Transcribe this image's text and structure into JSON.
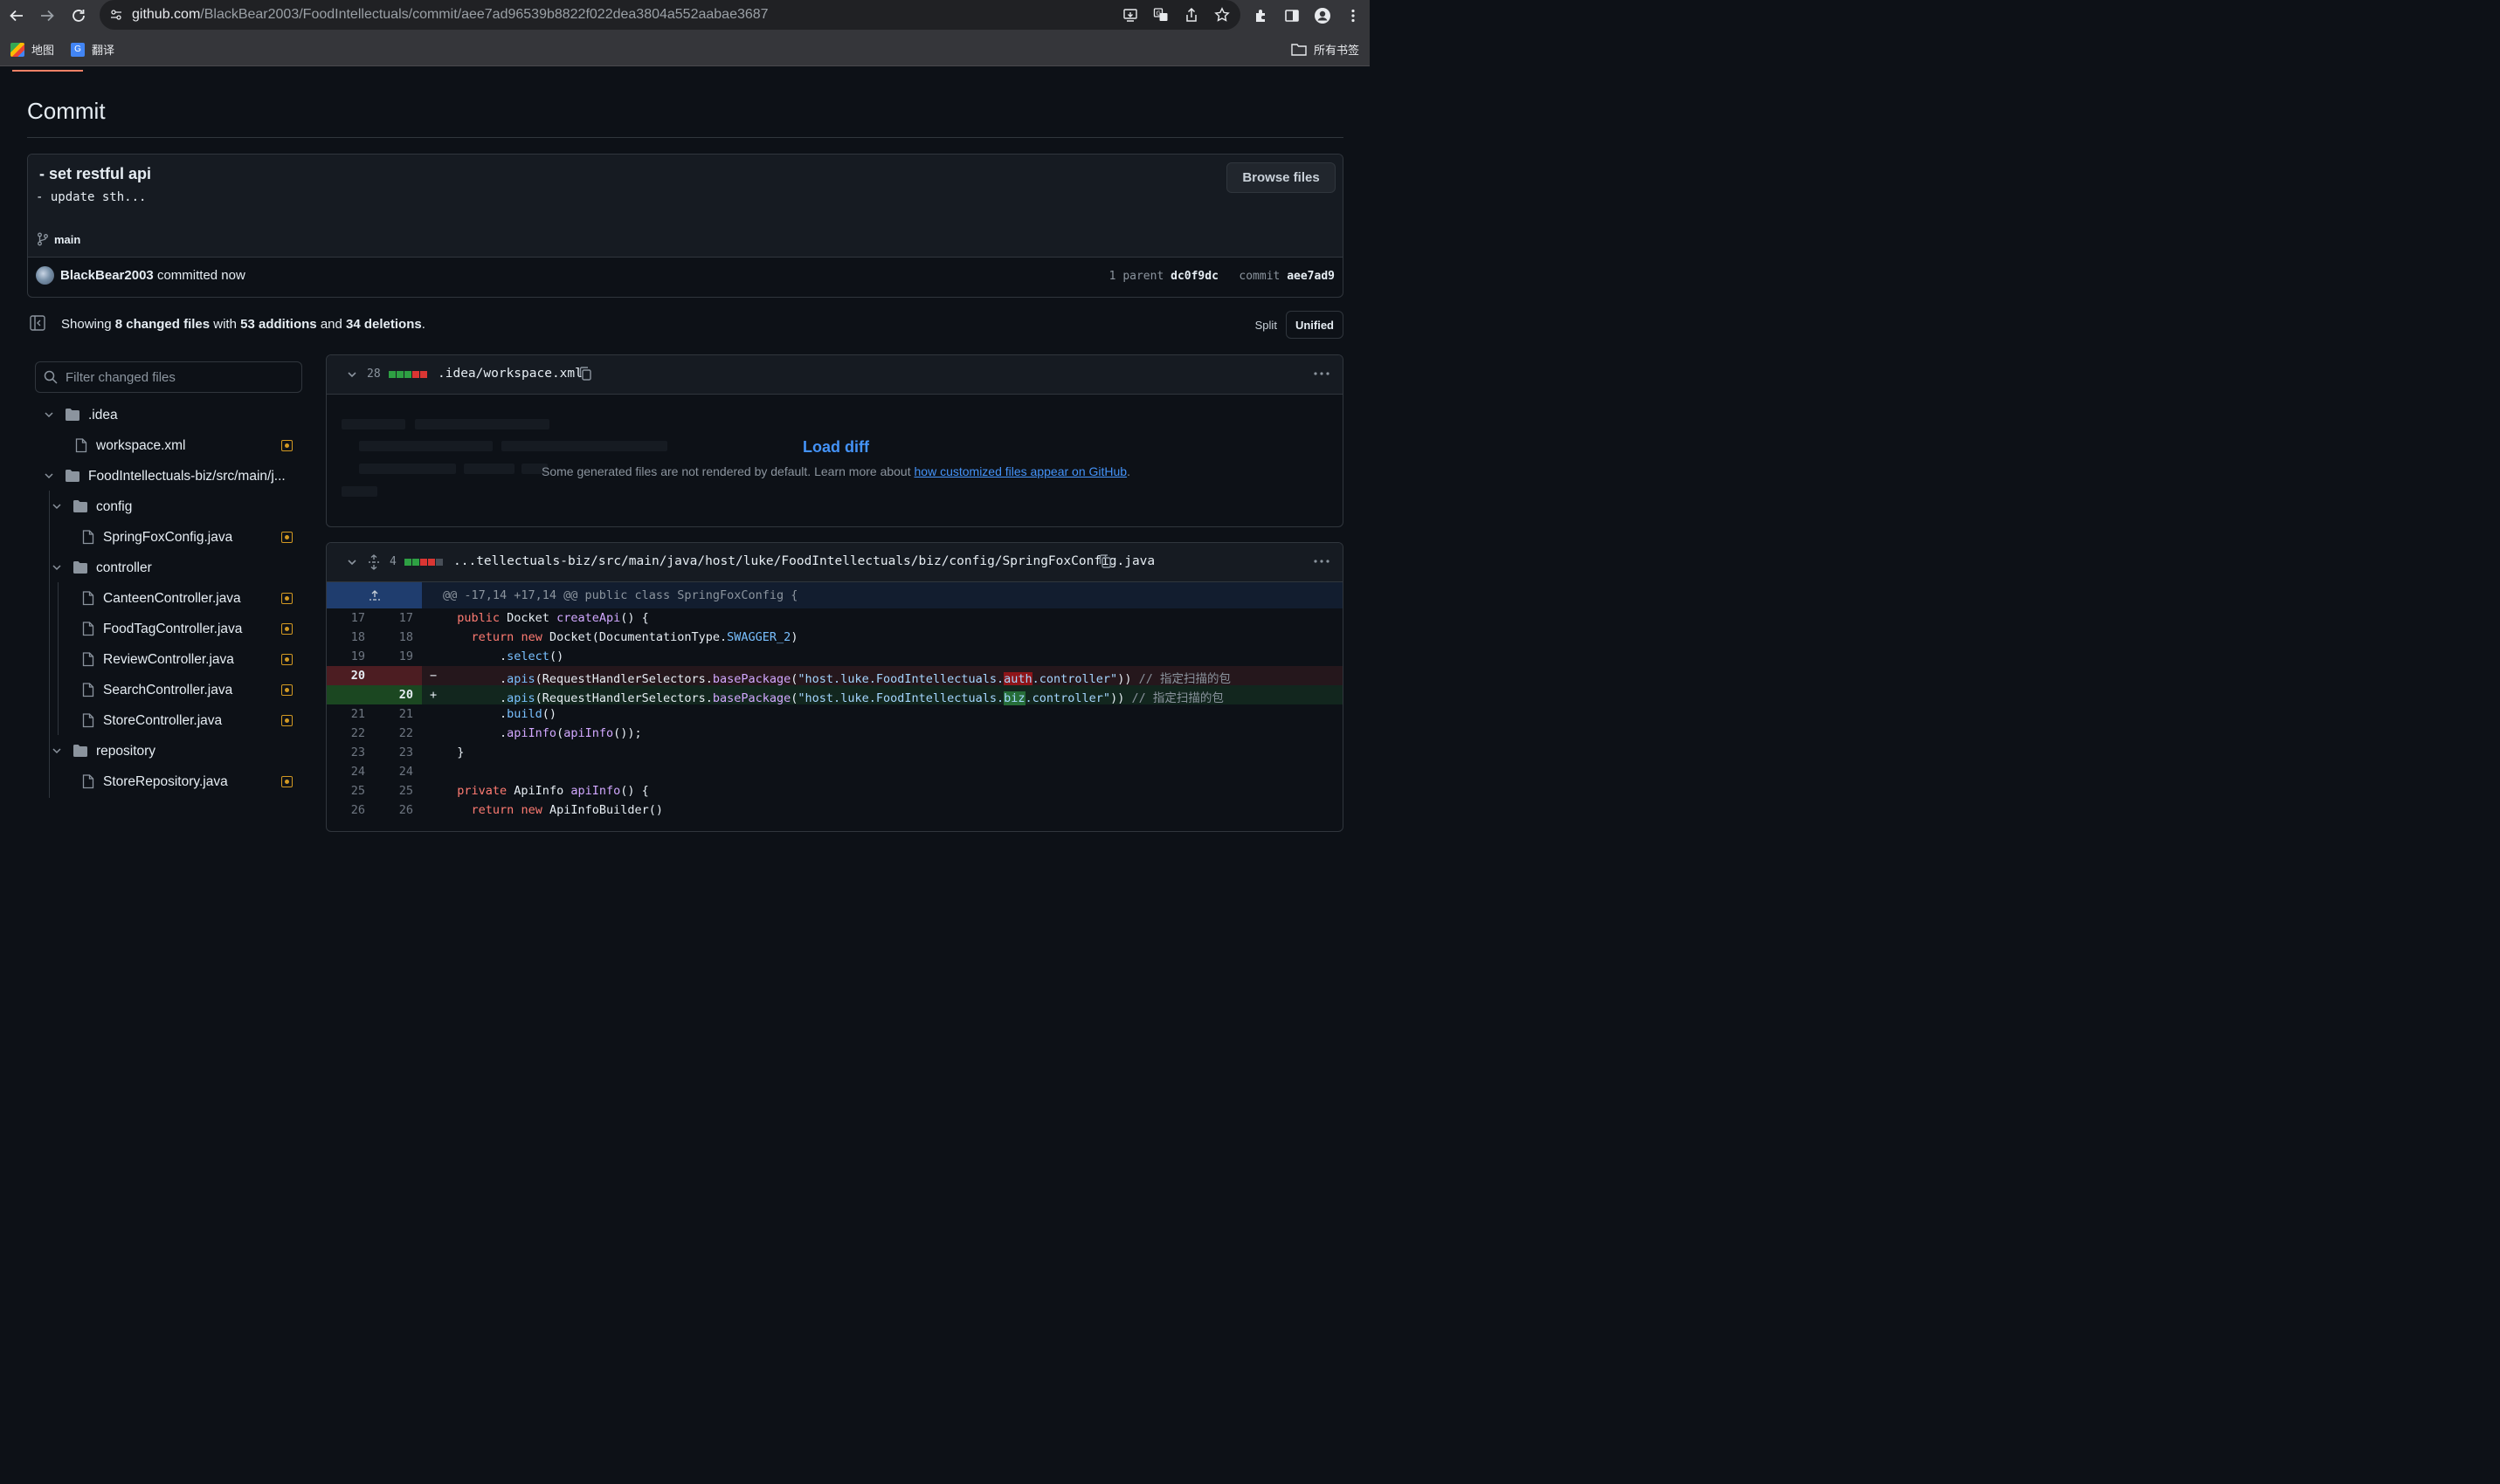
{
  "browser": {
    "url_host": "github.com",
    "url_path": "/BlackBear2003/FoodIntellectuals/commit/aee7ad96539b8822f022dea3804a552aabae3687",
    "bookmarks": [
      {
        "label": "地图",
        "icon": "maps-icon"
      },
      {
        "label": "翻译",
        "icon": "translate-icon"
      }
    ],
    "all_bookmarks_label": "所有书签",
    "colors": {
      "chrome": "#35363a",
      "omnibox": "#202124"
    }
  },
  "page": {
    "title": "Commit",
    "commit": {
      "title": "- set restful api",
      "description": "- update sth...",
      "browse_files_label": "Browse files",
      "branch": "main",
      "author": "BlackBear2003",
      "committed_text": "committed now",
      "parent_label": "1 parent",
      "parent_sha": "dc0f9dc",
      "commit_label": "commit",
      "commit_sha": "aee7ad9"
    },
    "summary": {
      "prefix": "Showing",
      "changed_files": "8 changed files",
      "with": "with",
      "additions": "53 additions",
      "and": "and",
      "deletions": "34 deletions",
      "suffix": "."
    },
    "view_toggle": {
      "split": "Split",
      "unified": "Unified",
      "selected": "Unified"
    },
    "colors": {
      "background": "#0d1117",
      "accent_link": "#4493f8",
      "addition": "#2ea043",
      "deletion": "#da3633",
      "modified_badge": "#d29922"
    }
  },
  "file_tree": {
    "filter_placeholder": "Filter changed files",
    "items": [
      {
        "label": ".idea",
        "type": "folder",
        "depth": 0
      },
      {
        "label": "workspace.xml",
        "type": "file",
        "depth": 1,
        "status": "modified"
      },
      {
        "label": "FoodIntellectuals-biz/src/main/j...",
        "type": "folder",
        "depth": 0
      },
      {
        "label": "config",
        "type": "folder",
        "depth": 1
      },
      {
        "label": "SpringFoxConfig.java",
        "type": "file",
        "depth": 2,
        "status": "modified"
      },
      {
        "label": "controller",
        "type": "folder",
        "depth": 1
      },
      {
        "label": "CanteenController.java",
        "type": "file",
        "depth": 2,
        "status": "modified"
      },
      {
        "label": "FoodTagController.java",
        "type": "file",
        "depth": 2,
        "status": "modified"
      },
      {
        "label": "ReviewController.java",
        "type": "file",
        "depth": 2,
        "status": "modified"
      },
      {
        "label": "SearchController.java",
        "type": "file",
        "depth": 2,
        "status": "modified"
      },
      {
        "label": "StoreController.java",
        "type": "file",
        "depth": 2,
        "status": "modified"
      },
      {
        "label": "repository",
        "type": "folder",
        "depth": 1
      },
      {
        "label": "StoreRepository.java",
        "type": "file",
        "depth": 2,
        "status": "modified"
      }
    ]
  },
  "diffs": [
    {
      "count": "28",
      "blocks": [
        "a",
        "a",
        "a",
        "d",
        "d"
      ],
      "path": ".idea/workspace.xml",
      "load_diff_label": "Load diff",
      "note_prefix": "Some generated files are not rendered by default. Learn more about",
      "note_link": "how customized files appear on GitHub",
      "note_suffix": "."
    },
    {
      "count": "4",
      "blocks": [
        "a",
        "a",
        "d",
        "d",
        "n"
      ],
      "path": "...tellectuals-biz/src/main/java/host/luke/FoodIntellectuals/biz/config/SpringFoxConfig.java",
      "hunk_header": "@@ -17,14 +17,14 @@ public class SpringFoxConfig {",
      "lines": [
        {
          "old": "17",
          "new": "17",
          "type": "ctx",
          "text": "  public Docket createApi() {"
        },
        {
          "old": "18",
          "new": "18",
          "type": "ctx",
          "text": "    return new Docket(DocumentationType.SWAGGER_2)"
        },
        {
          "old": "19",
          "new": "19",
          "type": "ctx",
          "text": "        .select()"
        },
        {
          "old": "20",
          "new": "",
          "type": "del",
          "sign": "−",
          "text": "        .apis(RequestHandlerSelectors.basePackage(\"host.luke.FoodIntellectuals.auth.controller\")) // 指定扫描的包"
        },
        {
          "old": "",
          "new": "20",
          "type": "add",
          "sign": "+",
          "text": "        .apis(RequestHandlerSelectors.basePackage(\"host.luke.FoodIntellectuals.biz.controller\")) // 指定扫描的包"
        },
        {
          "old": "21",
          "new": "21",
          "type": "ctx",
          "text": "        .build()"
        },
        {
          "old": "22",
          "new": "22",
          "type": "ctx",
          "text": "        .apiInfo(apiInfo());"
        },
        {
          "old": "23",
          "new": "23",
          "type": "ctx",
          "text": "  }"
        },
        {
          "old": "24",
          "new": "24",
          "type": "ctx",
          "text": ""
        },
        {
          "old": "25",
          "new": "25",
          "type": "ctx",
          "text": "  private ApiInfo apiInfo() {"
        },
        {
          "old": "26",
          "new": "26",
          "type": "ctx",
          "text": "    return new ApiInfoBuilder()"
        }
      ]
    }
  ]
}
